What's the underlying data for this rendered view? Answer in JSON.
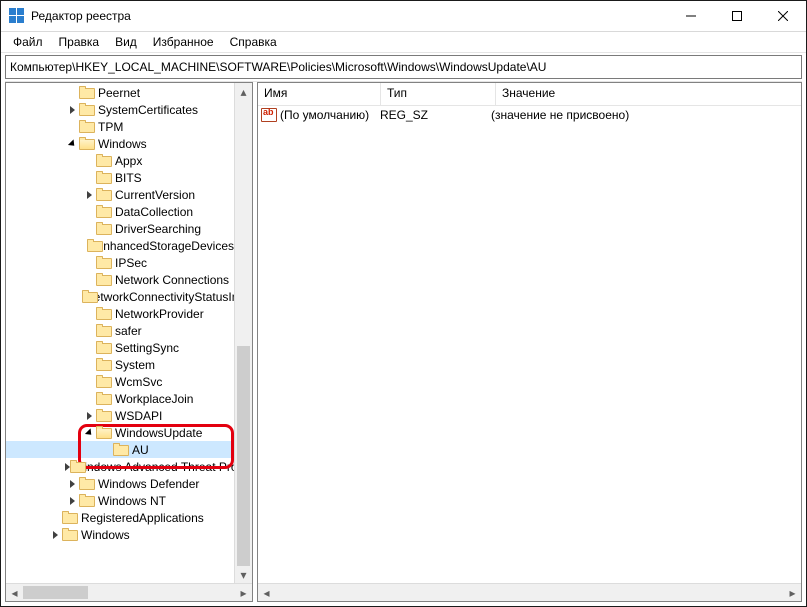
{
  "title": "Редактор реестра",
  "menu": {
    "file": "Файл",
    "edit": "Правка",
    "view": "Вид",
    "favorites": "Избранное",
    "help": "Справка"
  },
  "address": "Компьютер\\HKEY_LOCAL_MACHINE\\SOFTWARE\\Policies\\Microsoft\\Windows\\WindowsUpdate\\AU",
  "cols": {
    "name": "Имя",
    "type": "Тип",
    "value": "Значение"
  },
  "row": {
    "name": "(По умолчанию)",
    "type": "REG_SZ",
    "value": "(значение не присвоено)"
  },
  "tree": [
    {
      "d": 3,
      "tw": "",
      "label": "Peernet"
    },
    {
      "d": 3,
      "tw": "has",
      "label": "SystemCertificates"
    },
    {
      "d": 3,
      "tw": "",
      "label": "TPM"
    },
    {
      "d": 3,
      "tw": "open",
      "label": "Windows",
      "open": true
    },
    {
      "d": 4,
      "tw": "",
      "label": "Appx"
    },
    {
      "d": 4,
      "tw": "",
      "label": "BITS"
    },
    {
      "d": 4,
      "tw": "has",
      "label": "CurrentVersion"
    },
    {
      "d": 4,
      "tw": "",
      "label": "DataCollection"
    },
    {
      "d": 4,
      "tw": "",
      "label": "DriverSearching"
    },
    {
      "d": 4,
      "tw": "",
      "label": "EnhancedStorageDevices"
    },
    {
      "d": 4,
      "tw": "",
      "label": "IPSec"
    },
    {
      "d": 4,
      "tw": "",
      "label": "Network Connections"
    },
    {
      "d": 4,
      "tw": "",
      "label": "NetworkConnectivityStatusIndicator"
    },
    {
      "d": 4,
      "tw": "",
      "label": "NetworkProvider"
    },
    {
      "d": 4,
      "tw": "",
      "label": "safer"
    },
    {
      "d": 4,
      "tw": "",
      "label": "SettingSync"
    },
    {
      "d": 4,
      "tw": "",
      "label": "System"
    },
    {
      "d": 4,
      "tw": "",
      "label": "WcmSvc"
    },
    {
      "d": 4,
      "tw": "",
      "label": "WorkplaceJoin"
    },
    {
      "d": 4,
      "tw": "has",
      "label": "WSDAPI"
    },
    {
      "d": 4,
      "tw": "open",
      "label": "WindowsUpdate",
      "open": true
    },
    {
      "d": 5,
      "tw": "",
      "label": "AU",
      "sel": true
    },
    {
      "d": 3,
      "tw": "has",
      "label": "Windows Advanced Threat Protection"
    },
    {
      "d": 3,
      "tw": "has",
      "label": "Windows Defender"
    },
    {
      "d": 3,
      "tw": "has",
      "label": "Windows NT"
    },
    {
      "d": 2,
      "tw": "",
      "label": "RegisteredApplications"
    },
    {
      "d": 2,
      "tw": "has",
      "label": "Windows"
    }
  ]
}
